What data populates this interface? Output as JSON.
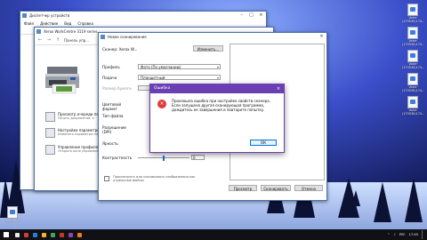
{
  "desktop": {
    "icons": [
      {
        "label": "Voice",
        "sub": "(170530)174..."
      },
      {
        "label": "Voice",
        "sub": "(170530)174..."
      },
      {
        "label": "Voice",
        "sub": "(170530)174..."
      },
      {
        "label": "Voice",
        "sub": "(170530)174..."
      },
      {
        "label": "Voice",
        "sub": "(170530)174..."
      }
    ],
    "trash_label": "Корзина"
  },
  "devmgr": {
    "title": "Диспетчер устройств",
    "menu": [
      "Файл",
      "Действие",
      "Вид",
      "Справка"
    ]
  },
  "printers": {
    "title": "Xerox WorkCentre 3119 series",
    "crumb": "Панель упр...",
    "links": [
      {
        "title": "Просмотр очереди печати",
        "sub": "Печать документов: 0"
      },
      {
        "title": "Настройка параметров печати",
        "sub": "Изменить параметры печати"
      },
      {
        "title": "Управление профилями",
        "sub": "Открыть окно управления..."
      }
    ]
  },
  "newscan": {
    "title": "Новое сканирование",
    "scanner_label": "Сканер: Xerox W...",
    "change_button": "Изменить...",
    "fields": {
      "profile_label": "Профиль",
      "profile_value": "Фото (По умолчанию)",
      "source_label": "Подача",
      "source_value": "Планшетный",
      "paper_label": "Размер бумаги",
      "color_label": "Цветовой формат",
      "filetype_label": "Тип файла",
      "resolution_label": "Разрешение (DPI)",
      "brightness_label": "Яркость",
      "contrast_label": "Контрастность",
      "contrast_value": "0"
    },
    "preview_as_separate": "Просмотреть или сканировать изображения как отдельные файлы",
    "buttons": {
      "preview": "Просмотр",
      "scan": "Сканировать",
      "cancel": "Отмена"
    }
  },
  "error_dialog": {
    "title": "Ошибка",
    "message": "Произошла ошибка при настройке свойств сканера. Если запущена другая сканирующая программа, дождитесь ее завершения и повторите попытку.",
    "ok": "ОК"
  },
  "taskbar": {
    "lang": "РУС",
    "time": "17:45",
    "icon_colors": [
      "#e8e8e8",
      "#d43b3b",
      "#2d7be0",
      "#f2b233",
      "#3aa55c",
      "#c0392b",
      "#8e44ad",
      "#e67e22"
    ]
  }
}
